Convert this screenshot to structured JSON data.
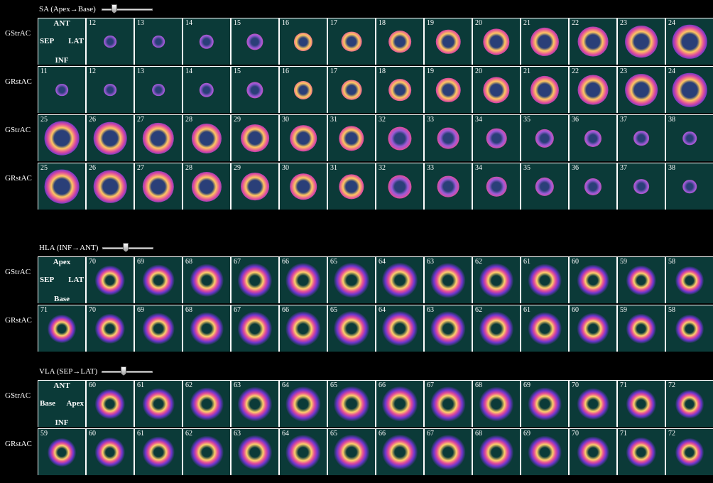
{
  "sections": [
    {
      "id": "sa",
      "title": "SA (Apex→Base)",
      "slider_fraction": 0.22,
      "orientation": {
        "top": "ANT",
        "left": "SEP",
        "right": "LAT",
        "bottom": "INF"
      },
      "rows": [
        {
          "label": "GStrAC",
          "shape": "ring",
          "slices": [
            "",
            "12",
            "13",
            "14",
            "15",
            "16",
            "17",
            "18",
            "19",
            "20",
            "21",
            "22",
            "23",
            "24"
          ]
        },
        {
          "label": "GRstAC",
          "shape": "ring",
          "slices": [
            "11",
            "12",
            "13",
            "14",
            "15",
            "16",
            "17",
            "18",
            "19",
            "20",
            "21",
            "22",
            "23",
            "24"
          ]
        },
        {
          "label": "GStrAC",
          "shape": "ring",
          "slices": [
            "25",
            "26",
            "27",
            "28",
            "29",
            "30",
            "31",
            "32",
            "33",
            "34",
            "35",
            "36",
            "37",
            "38"
          ]
        },
        {
          "label": "GRstAC",
          "shape": "ring",
          "slices": [
            "25",
            "26",
            "27",
            "28",
            "29",
            "30",
            "31",
            "32",
            "33",
            "34",
            "35",
            "36",
            "37",
            "38"
          ]
        }
      ]
    },
    {
      "id": "hla",
      "title": "HLA (INF→ANT)",
      "slider_fraction": 0.45,
      "orientation": {
        "top": "Apex",
        "left": "SEP",
        "right": "LAT",
        "bottom": "Base"
      },
      "rows": [
        {
          "label": "GStrAC",
          "shape": "arch",
          "slices": [
            "",
            "70",
            "69",
            "68",
            "67",
            "66",
            "65",
            "64",
            "63",
            "62",
            "61",
            "60",
            "59",
            "58"
          ]
        },
        {
          "label": "GRstAC",
          "shape": "arch",
          "slices": [
            "71",
            "70",
            "69",
            "68",
            "67",
            "66",
            "65",
            "64",
            "63",
            "62",
            "61",
            "60",
            "59",
            "58"
          ]
        }
      ]
    },
    {
      "id": "vla",
      "title": "VLA (SEP→LAT)",
      "slider_fraction": 0.42,
      "orientation": {
        "top": "ANT",
        "left": "Base",
        "right": "Apex",
        "bottom": "INF"
      },
      "rows": [
        {
          "label": "GStrAC",
          "shape": "horseshoe",
          "slices": [
            "",
            "60",
            "61",
            "62",
            "63",
            "64",
            "65",
            "66",
            "67",
            "68",
            "69",
            "70",
            "71",
            "72"
          ]
        },
        {
          "label": "GRstAC",
          "shape": "horseshoe",
          "slices": [
            "59",
            "60",
            "61",
            "62",
            "63",
            "64",
            "65",
            "66",
            "67",
            "68",
            "69",
            "70",
            "71",
            "72"
          ]
        }
      ]
    }
  ],
  "colors": {
    "background": "#000000",
    "tissue": "#0b3a38",
    "grid": "#ffffff"
  }
}
